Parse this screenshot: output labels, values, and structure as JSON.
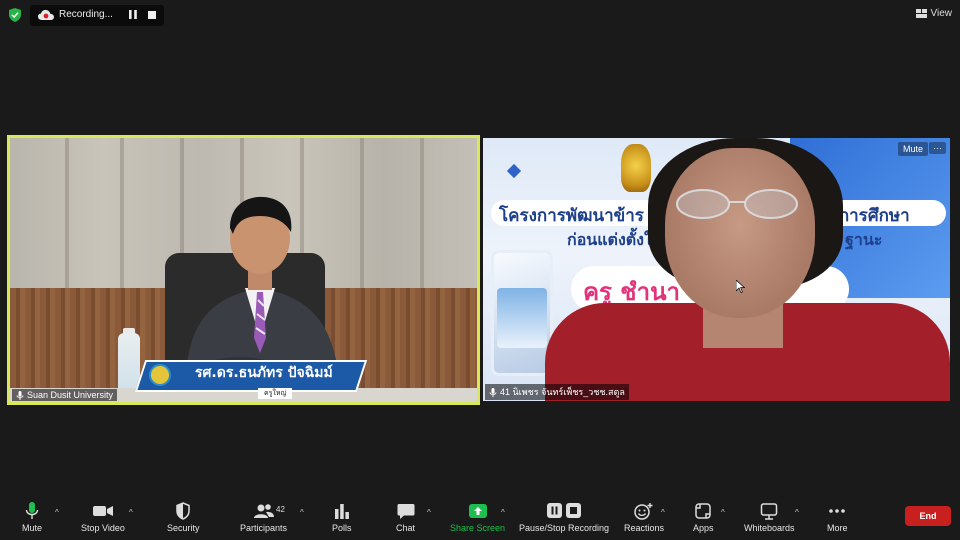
{
  "recording": {
    "label": "Recording..."
  },
  "view": {
    "label": "View"
  },
  "participants_left": {
    "name": "Suan Dusit University",
    "banner_name": "รศ.ดร.ธนภัทร ปัจฉิมม์",
    "banner_sub": "ครูใหญ่"
  },
  "participants_right": {
    "name": "41 นิเพชร จันทร์เพ็ชร_วชช.สตูล",
    "mute_label": "Mute",
    "more_label": "···",
    "slide_line1": "โครงการพัฒนาข้าร",
    "slide_line1b": "างการศึกษา",
    "slide_line2": "ก่อนแต่งตั้งใ",
    "slide_line2b": "ฐานะ",
    "slide_line3": "ครู ชำนา"
  },
  "toolbar": {
    "mute": "Mute",
    "stop_video": "Stop Video",
    "security": "Security",
    "participants": "Participants",
    "participants_count": "42",
    "polls": "Polls",
    "chat": "Chat",
    "share_screen": "Share Screen",
    "pause_stop_recording": "Pause/Stop Recording",
    "reactions": "Reactions",
    "apps": "Apps",
    "whiteboards": "Whiteboards",
    "more": "More",
    "end": "End"
  },
  "colors": {
    "active_speaker_border": "#d8e85a",
    "share_green": "#1fbf4f",
    "end_red": "#c8201f",
    "security_green": "#2bb34a"
  }
}
